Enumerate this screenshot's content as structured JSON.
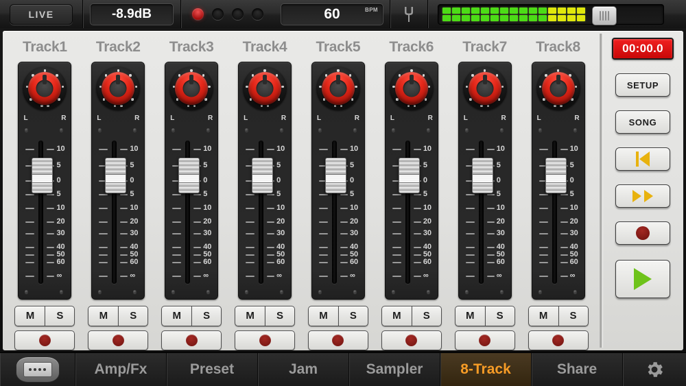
{
  "topbar": {
    "live_label": "LIVE",
    "db_value": "-8.9dB",
    "bpm_value": "60",
    "bpm_label": "BPM",
    "tuner_icon": "tuning-fork-icon",
    "beats": [
      true,
      false,
      false,
      false
    ],
    "meter": {
      "rows": 2,
      "segments_total": 15,
      "segments_lit": 15,
      "green_hex": "#4cdc16",
      "yellow_hex": "#e0e80c",
      "handle_position_pct": 68
    }
  },
  "tracks": [
    {
      "title": "Track1",
      "mute_label": "M",
      "solo_label": "S",
      "record_icon": "record-dot-icon"
    },
    {
      "title": "Track2",
      "mute_label": "M",
      "solo_label": "S",
      "record_icon": "record-dot-icon"
    },
    {
      "title": "Track3",
      "mute_label": "M",
      "solo_label": "S",
      "record_icon": "record-dot-icon"
    },
    {
      "title": "Track4",
      "mute_label": "M",
      "solo_label": "S",
      "record_icon": "record-dot-icon"
    },
    {
      "title": "Track5",
      "mute_label": "M",
      "solo_label": "S",
      "record_icon": "record-dot-icon"
    },
    {
      "title": "Track6",
      "mute_label": "M",
      "solo_label": "S",
      "record_icon": "record-dot-icon"
    },
    {
      "title": "Track7",
      "mute_label": "M",
      "solo_label": "S",
      "record_icon": "record-dot-icon"
    },
    {
      "title": "Track8",
      "mute_label": "M",
      "solo_label": "S",
      "record_icon": "record-dot-icon"
    }
  ],
  "pan": {
    "left_label": "L",
    "right_label": "R",
    "knob_color": "#e02618"
  },
  "fader_scale": {
    "labels": [
      "10",
      "5",
      "0",
      "5",
      "10",
      "20",
      "30",
      "40",
      "50",
      "60",
      "∞"
    ],
    "positions_pct": [
      8,
      19,
      29,
      38,
      47,
      56,
      64,
      73,
      78,
      83,
      92
    ],
    "cap_top_pct": 14
  },
  "transport": {
    "time_display": "00:00.0",
    "setup_label": "SETUP",
    "song_label": "SONG",
    "rewind_icon": "rewind-to-start-icon",
    "forward_icon": "fast-forward-icon",
    "record_icon": "record-circle-icon",
    "play_icon": "play-triangle-icon"
  },
  "tabbar": {
    "pedal_icon": "stompbox-pedal-icon",
    "gear_icon": "gear-icon",
    "tabs": [
      {
        "label": "Amp/Fx",
        "active": false
      },
      {
        "label": "Preset",
        "active": false
      },
      {
        "label": "Jam",
        "active": false
      },
      {
        "label": "Sampler",
        "active": false
      },
      {
        "label": "8-Track",
        "active": true
      },
      {
        "label": "Share",
        "active": false
      }
    ],
    "active_color": "#f79c26"
  }
}
